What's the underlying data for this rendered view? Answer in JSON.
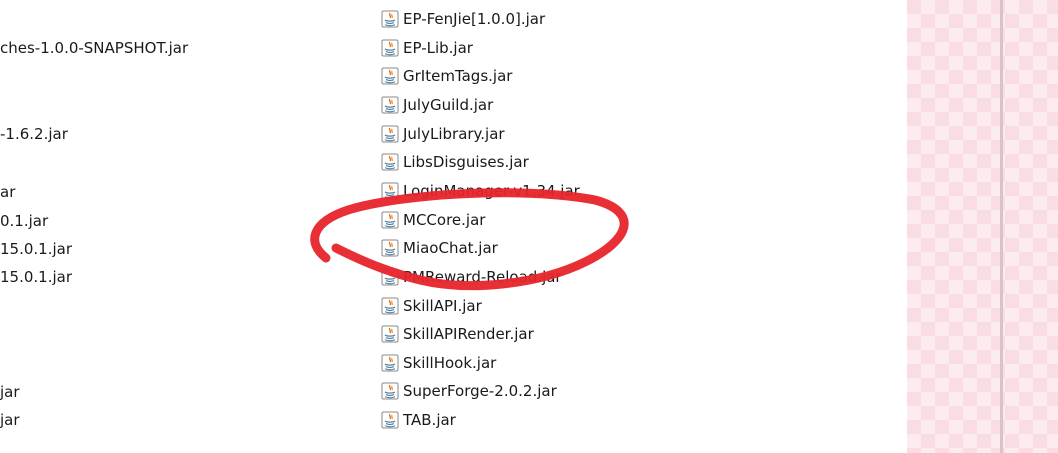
{
  "left_column": {
    "items": [
      {
        "text": "ches-1.0.0-SNAPSHOT.jar"
      },
      {
        "text": "-1.6.2.jar"
      },
      {
        "text": "ar"
      },
      {
        "text": "0.1.jar"
      },
      {
        "text": "15.0.1.jar"
      },
      {
        "text": "15.0.1.jar"
      },
      {
        "text": "jar"
      },
      {
        "text": "jar"
      }
    ]
  },
  "files": [
    {
      "name": "EP-FenJie[1.0.0].jar"
    },
    {
      "name": "EP-Lib.jar"
    },
    {
      "name": "GrItemTags.jar"
    },
    {
      "name": "JulyGuild.jar"
    },
    {
      "name": "JulyLibrary.jar"
    },
    {
      "name": "LibsDisguises.jar"
    },
    {
      "name": "LoginManager-v1.34.jar"
    },
    {
      "name": "MCCore.jar"
    },
    {
      "name": "MiaoChat.jar"
    },
    {
      "name": "PMReward-Reload.jar"
    },
    {
      "name": "SkillAPI.jar"
    },
    {
      "name": "SkillAPIRender.jar"
    },
    {
      "name": "SkillHook.jar"
    },
    {
      "name": "SuperForge-2.0.2.jar"
    },
    {
      "name": "TAB.jar"
    }
  ],
  "icons": {
    "file": "java-jar-file-icon"
  },
  "colors": {
    "annotation": "#e8242b",
    "wallpaper": "#f9dde3"
  }
}
